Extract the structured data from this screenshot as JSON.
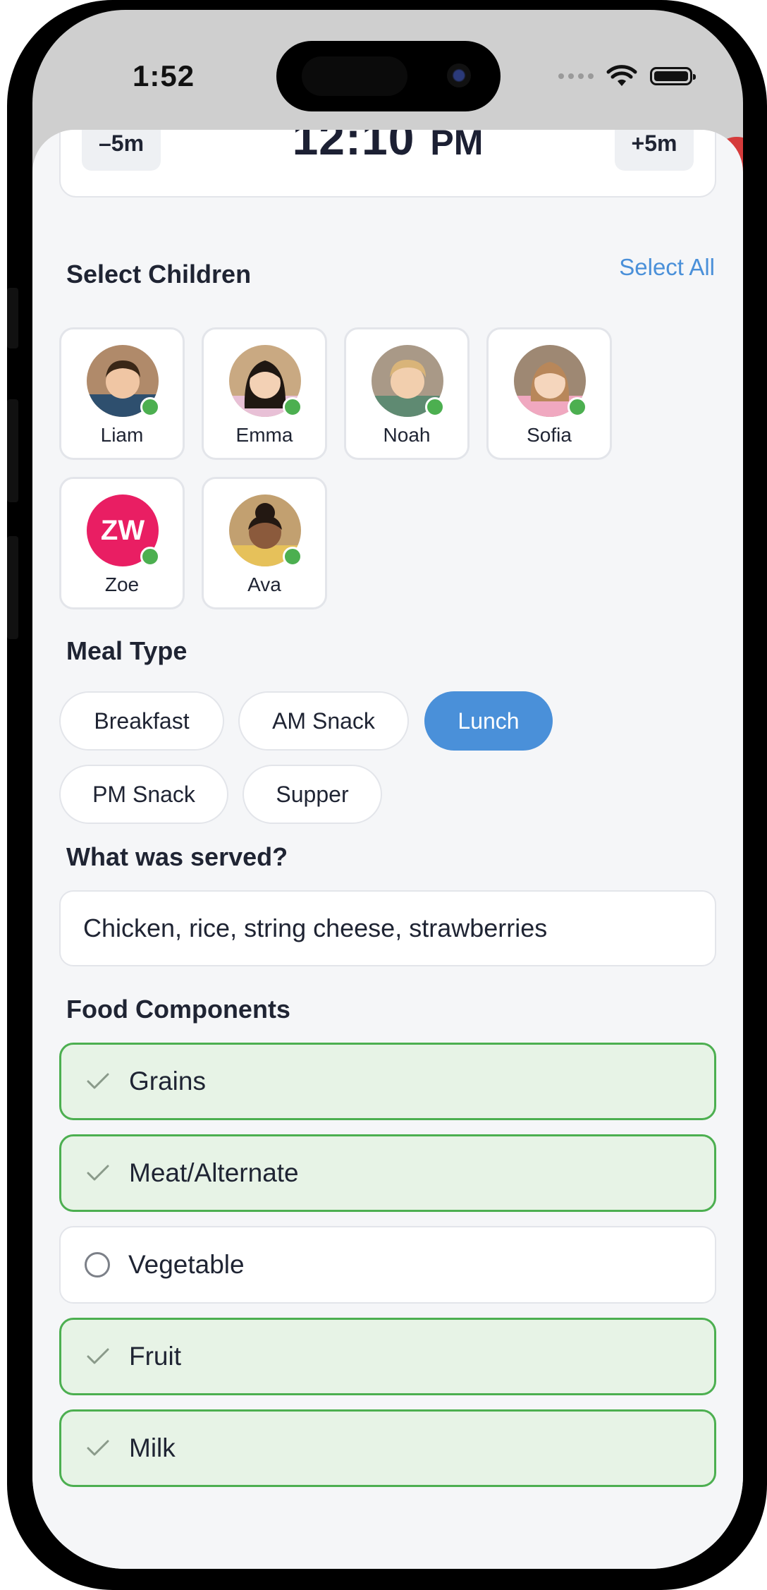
{
  "status_bar": {
    "time": "1:52"
  },
  "time_picker": {
    "minus_label": "–5m",
    "time": "12:10",
    "ampm": "PM",
    "plus_label": "+5m"
  },
  "children_section": {
    "title": "Select Children",
    "select_all": "Select All",
    "children": [
      {
        "name": "Liam",
        "status": "online"
      },
      {
        "name": "Emma",
        "status": "online"
      },
      {
        "name": "Noah",
        "status": "online"
      },
      {
        "name": "Sofia",
        "status": "online"
      },
      {
        "name": "Zoe",
        "initials": "ZW",
        "status": "online",
        "color": "#e91e63"
      },
      {
        "name": "Ava",
        "status": "online"
      }
    ]
  },
  "meal_type": {
    "title": "Meal Type",
    "options": [
      "Breakfast",
      "AM Snack",
      "Lunch",
      "PM Snack",
      "Supper"
    ],
    "selected": "Lunch"
  },
  "served": {
    "title": "What was served?",
    "value": "Chicken, rice, string cheese, strawberries"
  },
  "food_components": {
    "title": "Food Components",
    "items": [
      {
        "label": "Grains",
        "checked": true
      },
      {
        "label": "Meat/Alternate",
        "checked": true
      },
      {
        "label": "Vegetable",
        "checked": false
      },
      {
        "label": "Fruit",
        "checked": true
      },
      {
        "label": "Milk",
        "checked": true
      }
    ]
  },
  "colors": {
    "accent": "#4a90d9",
    "checked_bg": "#e7f3e6",
    "checked_border": "#4caf50",
    "online": "#4caf50"
  }
}
